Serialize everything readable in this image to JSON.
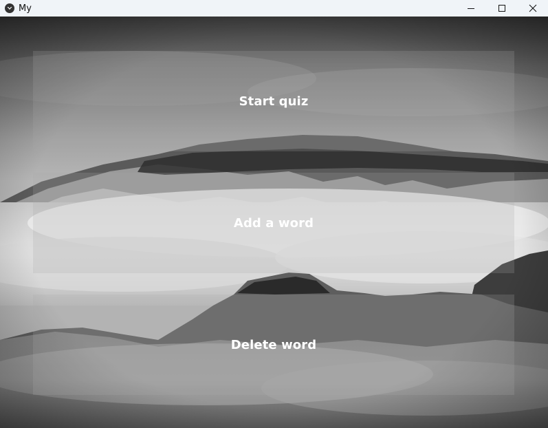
{
  "window": {
    "title": "My",
    "minimize_icon": "minimize-icon",
    "maximize_icon": "maximize-icon",
    "close_icon": "close-icon"
  },
  "menu": {
    "start_quiz_label": "Start quiz",
    "add_word_label": "Add a word",
    "delete_word_label": "Delete word"
  },
  "colors": {
    "titlebar_bg": "#f0f4f8",
    "button_overlay": "rgba(170,170,170,0.22)",
    "button_text": "#ffffff"
  }
}
